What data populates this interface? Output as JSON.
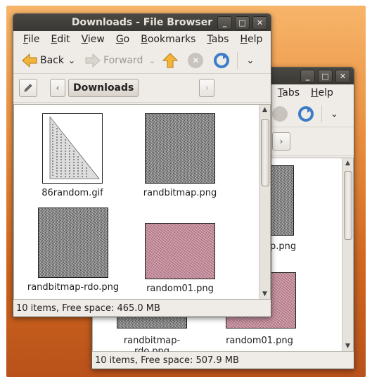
{
  "back_window": {
    "menu": [
      "Tabs",
      "Help"
    ],
    "status": "10 items, Free space: 507.9 MB",
    "files": [
      {
        "label": "p.png"
      },
      {
        "label": "randbitmap-rdo.png"
      },
      {
        "label": "random01.png"
      }
    ]
  },
  "front_window": {
    "title": "Downloads - File Browser",
    "menu": [
      "File",
      "Edit",
      "View",
      "Go",
      "Bookmarks",
      "Tabs",
      "Help"
    ],
    "toolbar": {
      "back": "Back",
      "forward": "Forward"
    },
    "location": {
      "current": "Downloads"
    },
    "status": "10 items, Free space: 465.0 MB",
    "files": [
      {
        "label": "86random.gif",
        "icon": "triangle-image"
      },
      {
        "label": "randbitmap.png",
        "icon": "gray-noise-image"
      },
      {
        "label": "randbitmap-rdo.png",
        "icon": "gray-noise-image"
      },
      {
        "label": "random01.png",
        "icon": "pink-noise-image"
      }
    ]
  },
  "window_buttons": [
    "_",
    "□",
    "✕"
  ],
  "colors": {
    "accent_orange": "#e98e3e",
    "titlebar": "#3a3834"
  }
}
